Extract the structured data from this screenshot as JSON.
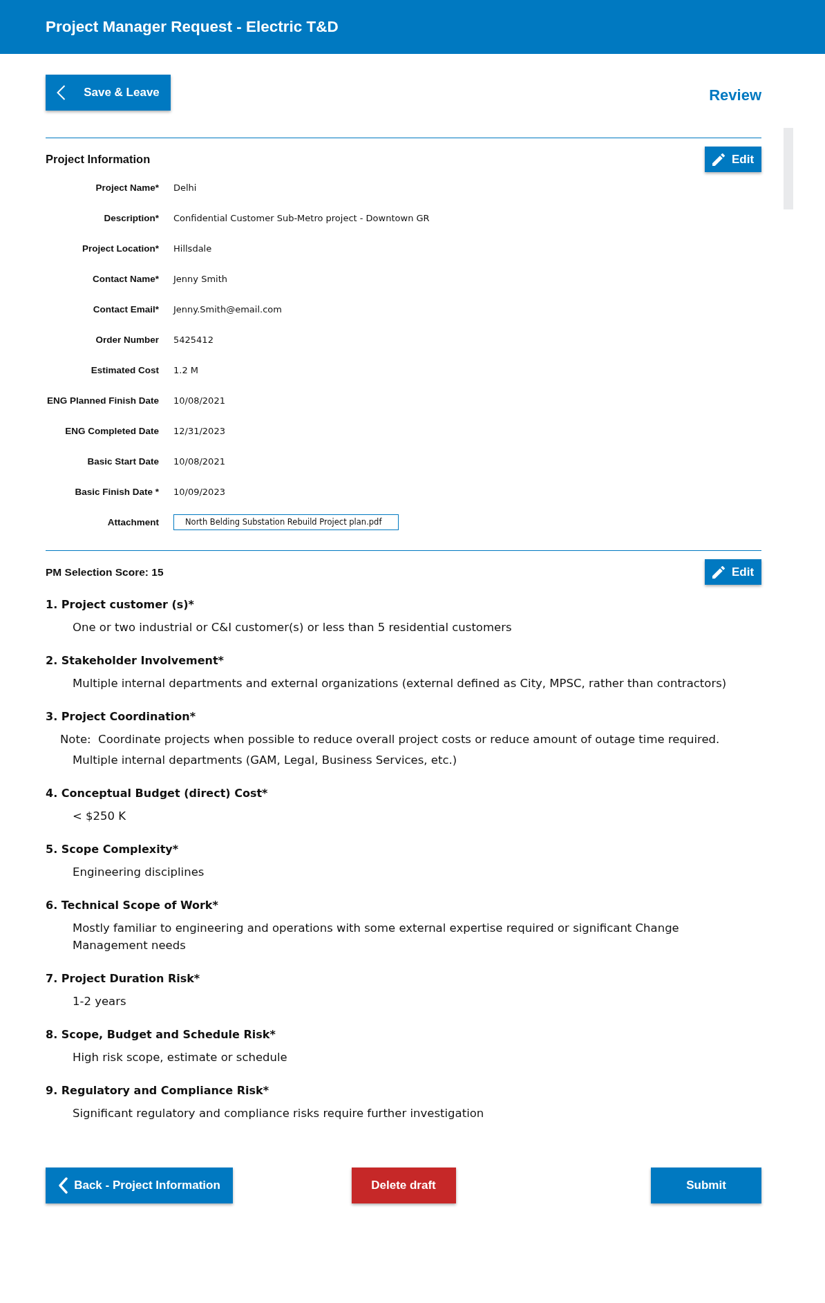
{
  "header": {
    "title": "Project Manager Request - Electric T&D"
  },
  "toolbar": {
    "save_button": "Save & Leave",
    "step_title": "Review"
  },
  "project_information": {
    "title": "Project Information",
    "edit_button": "Edit",
    "fields": [
      {
        "label": "Project Name*",
        "value": "Delhi",
        "kind": "text"
      },
      {
        "label": "Description*",
        "value": "Confidential Customer Sub-Metro project - Downtown GR",
        "kind": "text"
      },
      {
        "label": "Project Location*",
        "value": "Hillsdale",
        "kind": "text"
      },
      {
        "label": "Contact Name*",
        "value": "Jenny Smith",
        "kind": "text"
      },
      {
        "label": "Contact Email*",
        "value": "Jenny.Smith@email.com",
        "kind": "text"
      },
      {
        "label": "Order Number",
        "value": "5425412",
        "kind": "text"
      },
      {
        "label": "Estimated Cost",
        "value": "1.2 M",
        "kind": "text"
      },
      {
        "label": "ENG Planned Finish Date",
        "value": "10/08/2021",
        "kind": "text"
      },
      {
        "label": "ENG Completed Date",
        "value": "12/31/2023",
        "kind": "text"
      },
      {
        "label": "Basic Start Date",
        "value": "10/08/2021",
        "kind": "text"
      },
      {
        "label": "Basic Finish Date *",
        "value": "10/09/2023",
        "kind": "text"
      },
      {
        "label": "Attachment",
        "value": "North Belding Substation Rebuild Project plan.pdf",
        "kind": "attachment"
      }
    ]
  },
  "pm_selection": {
    "title": "PM Selection Score: 15",
    "edit_button": "Edit",
    "questions": [
      {
        "title": "1. Project customer (s)*",
        "answer": "One or two industrial or C&I customer(s) or less than 5 residential customers"
      },
      {
        "title": "2. Stakeholder Involvement*",
        "answer": "Multiple internal departments and external organizations (external defined as City, MPSC, rather than contractors)"
      },
      {
        "title": "3. Project Coordination*",
        "note": "Note:  Coordinate projects when possible to reduce overall project costs or reduce amount of outage time required.",
        "answer": "Multiple internal departments (GAM, Legal, Business Services, etc.)"
      },
      {
        "title": "4. Conceptual Budget (direct) Cost*",
        "answer": "< $250 K"
      },
      {
        "title": "5. Scope Complexity*",
        "answer": "Engineering disciplines"
      },
      {
        "title": "6. Technical Scope of Work*",
        "answer": "Mostly familiar to engineering and operations with some external expertise required or significant Change Management needs"
      },
      {
        "title": "7. Project Duration Risk*",
        "answer": "1-2 years"
      },
      {
        "title": "8. Scope, Budget and Schedule Risk*",
        "answer": "High risk scope, estimate or schedule"
      },
      {
        "title": "9. Regulatory and Compliance Risk*",
        "answer": "Significant regulatory and compliance risks require further investigation"
      }
    ]
  },
  "actions": [
    {
      "label": "Back - Project Information",
      "kind": "back"
    },
    {
      "label": "Delete draft",
      "kind": "danger"
    },
    {
      "label": "Submit",
      "kind": "primary"
    }
  ]
}
